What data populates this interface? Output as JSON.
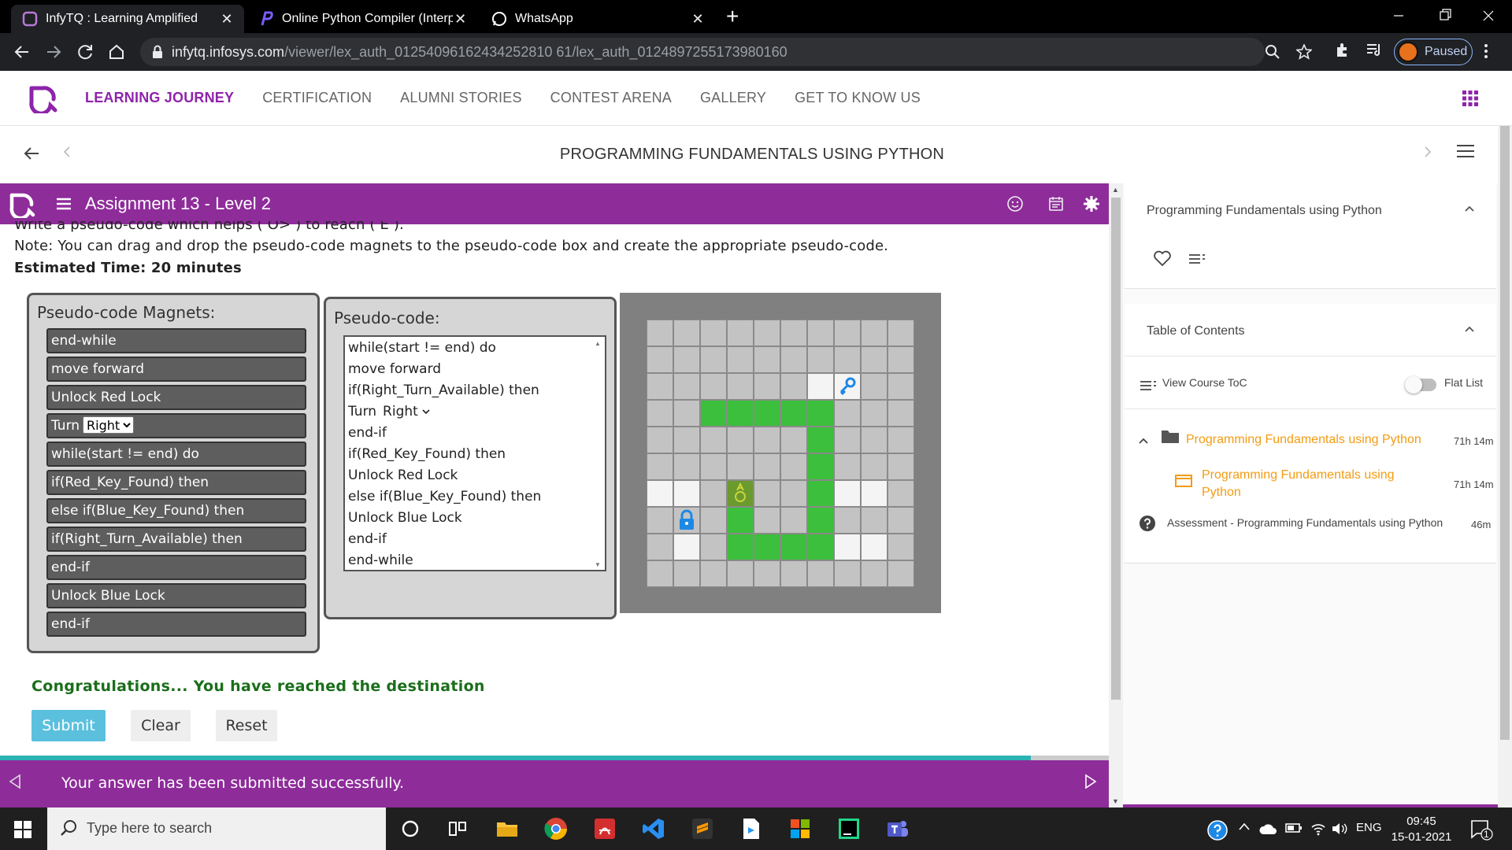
{
  "browser": {
    "tabs": [
      {
        "title": "InfyTQ : Learning Amplified",
        "active": true
      },
      {
        "title": "Online Python Compiler (Interpre",
        "active": false
      },
      {
        "title": "WhatsApp",
        "active": false
      }
    ],
    "close_glyph": "✕",
    "new_tab_glyph": "+",
    "url_host": "infytq.infosys.com",
    "url_path": "/viewer/lex_auth_01254096162434252810 61/lex_auth_0124897255173980160",
    "profile_label": "Paused"
  },
  "site_nav": {
    "links": [
      "LEARNING JOURNEY",
      "CERTIFICATION",
      "ALUMNI STORIES",
      "CONTEST ARENA",
      "GALLERY",
      "GET TO KNOW US"
    ]
  },
  "course": {
    "title": "PROGRAMMING FUNDAMENTALS USING PYTHON"
  },
  "assignment": {
    "title": "Assignment 13 - Level 2",
    "question_line": "Write a pseudo-code which helps ( O> ) to reach ( E ).",
    "note": "Note: You can drag and drop the pseudo-code magnets to the pseudo-code box and create the appropriate pseudo-code.",
    "estimated_time": "Estimated Time: 20 minutes",
    "magnets_title": "Pseudo-code Magnets:",
    "magnets": [
      {
        "text": "end-while"
      },
      {
        "text": "move forward"
      },
      {
        "text": "Unlock Red Lock"
      },
      {
        "text": "Turn",
        "select": "Right"
      },
      {
        "text": "while(start != end) do"
      },
      {
        "text": "if(Red_Key_Found) then"
      },
      {
        "text": "else if(Blue_Key_Found) then"
      },
      {
        "text": "if(Right_Turn_Available) then"
      },
      {
        "text": "end-if"
      },
      {
        "text": "Unlock Blue Lock"
      },
      {
        "text": "end-if"
      }
    ],
    "code_title": "Pseudo-code:",
    "code_lines": [
      {
        "text": "while(start != end) do"
      },
      {
        "text": "move forward"
      },
      {
        "text": "if(Right_Turn_Available) then"
      },
      {
        "text": "Turn",
        "select": "Right"
      },
      {
        "text": "end-if"
      },
      {
        "text": "if(Red_Key_Found) then"
      },
      {
        "text": "Unlock Red Lock"
      },
      {
        "text": "else if(Blue_Key_Found) then"
      },
      {
        "text": "Unlock Blue Lock"
      },
      {
        "text": "end-if"
      },
      {
        "text": "end-while"
      }
    ],
    "board": {
      "cols": 10,
      "rows": 10,
      "colors": {
        "gray": "#c3c3c3",
        "white": "#f4f4f4",
        "green": "#3cbf3c",
        "robot": "#6b9a2e"
      },
      "white_cells": [
        [
          2,
          6
        ],
        [
          2,
          7
        ],
        [
          6,
          0
        ],
        [
          6,
          1
        ],
        [
          6,
          7
        ],
        [
          6,
          8
        ],
        [
          8,
          1
        ],
        [
          8,
          7
        ],
        [
          8,
          8
        ]
      ],
      "green_cells": [
        [
          3,
          2
        ],
        [
          3,
          3
        ],
        [
          3,
          4
        ],
        [
          3,
          5
        ],
        [
          3,
          6
        ],
        [
          4,
          6
        ],
        [
          5,
          6
        ],
        [
          6,
          6
        ],
        [
          7,
          6
        ],
        [
          8,
          6
        ],
        [
          8,
          5
        ],
        [
          8,
          4
        ],
        [
          8,
          3
        ],
        [
          7,
          3
        ],
        [
          6,
          3
        ]
      ],
      "key_cell": [
        2,
        7
      ],
      "lock_cell": [
        7,
        1
      ],
      "robot_cell": [
        6,
        3
      ],
      "robot_label": "A"
    },
    "congrats": "Congratulations... You have reached the destination",
    "buttons": {
      "submit": "Submit",
      "clear": "Clear",
      "reset": "Reset"
    },
    "progress_fraction": 0.93,
    "footer_message": "Your answer has been submitted successfully."
  },
  "sidebar": {
    "course_card_title": "Programming Fundamentals using Python",
    "toc_title": "Table of Contents",
    "view_toc": "View Course ToC",
    "flat_list": "Flat List",
    "module": {
      "title": "Programming Fundamentals using Python",
      "duration": "71h 14m"
    },
    "submodule": {
      "title_line1": "Programming Fundamentals using",
      "title_line2": "Python",
      "duration": "71h 14m"
    },
    "assessment": {
      "title": "Assessment - Programming Fundamentals using Python",
      "duration": "46m"
    }
  },
  "taskbar": {
    "search_placeholder": "Type here to search",
    "language": "ENG",
    "time": "09:45",
    "date": "15-01-2021",
    "notification_count": "1"
  }
}
